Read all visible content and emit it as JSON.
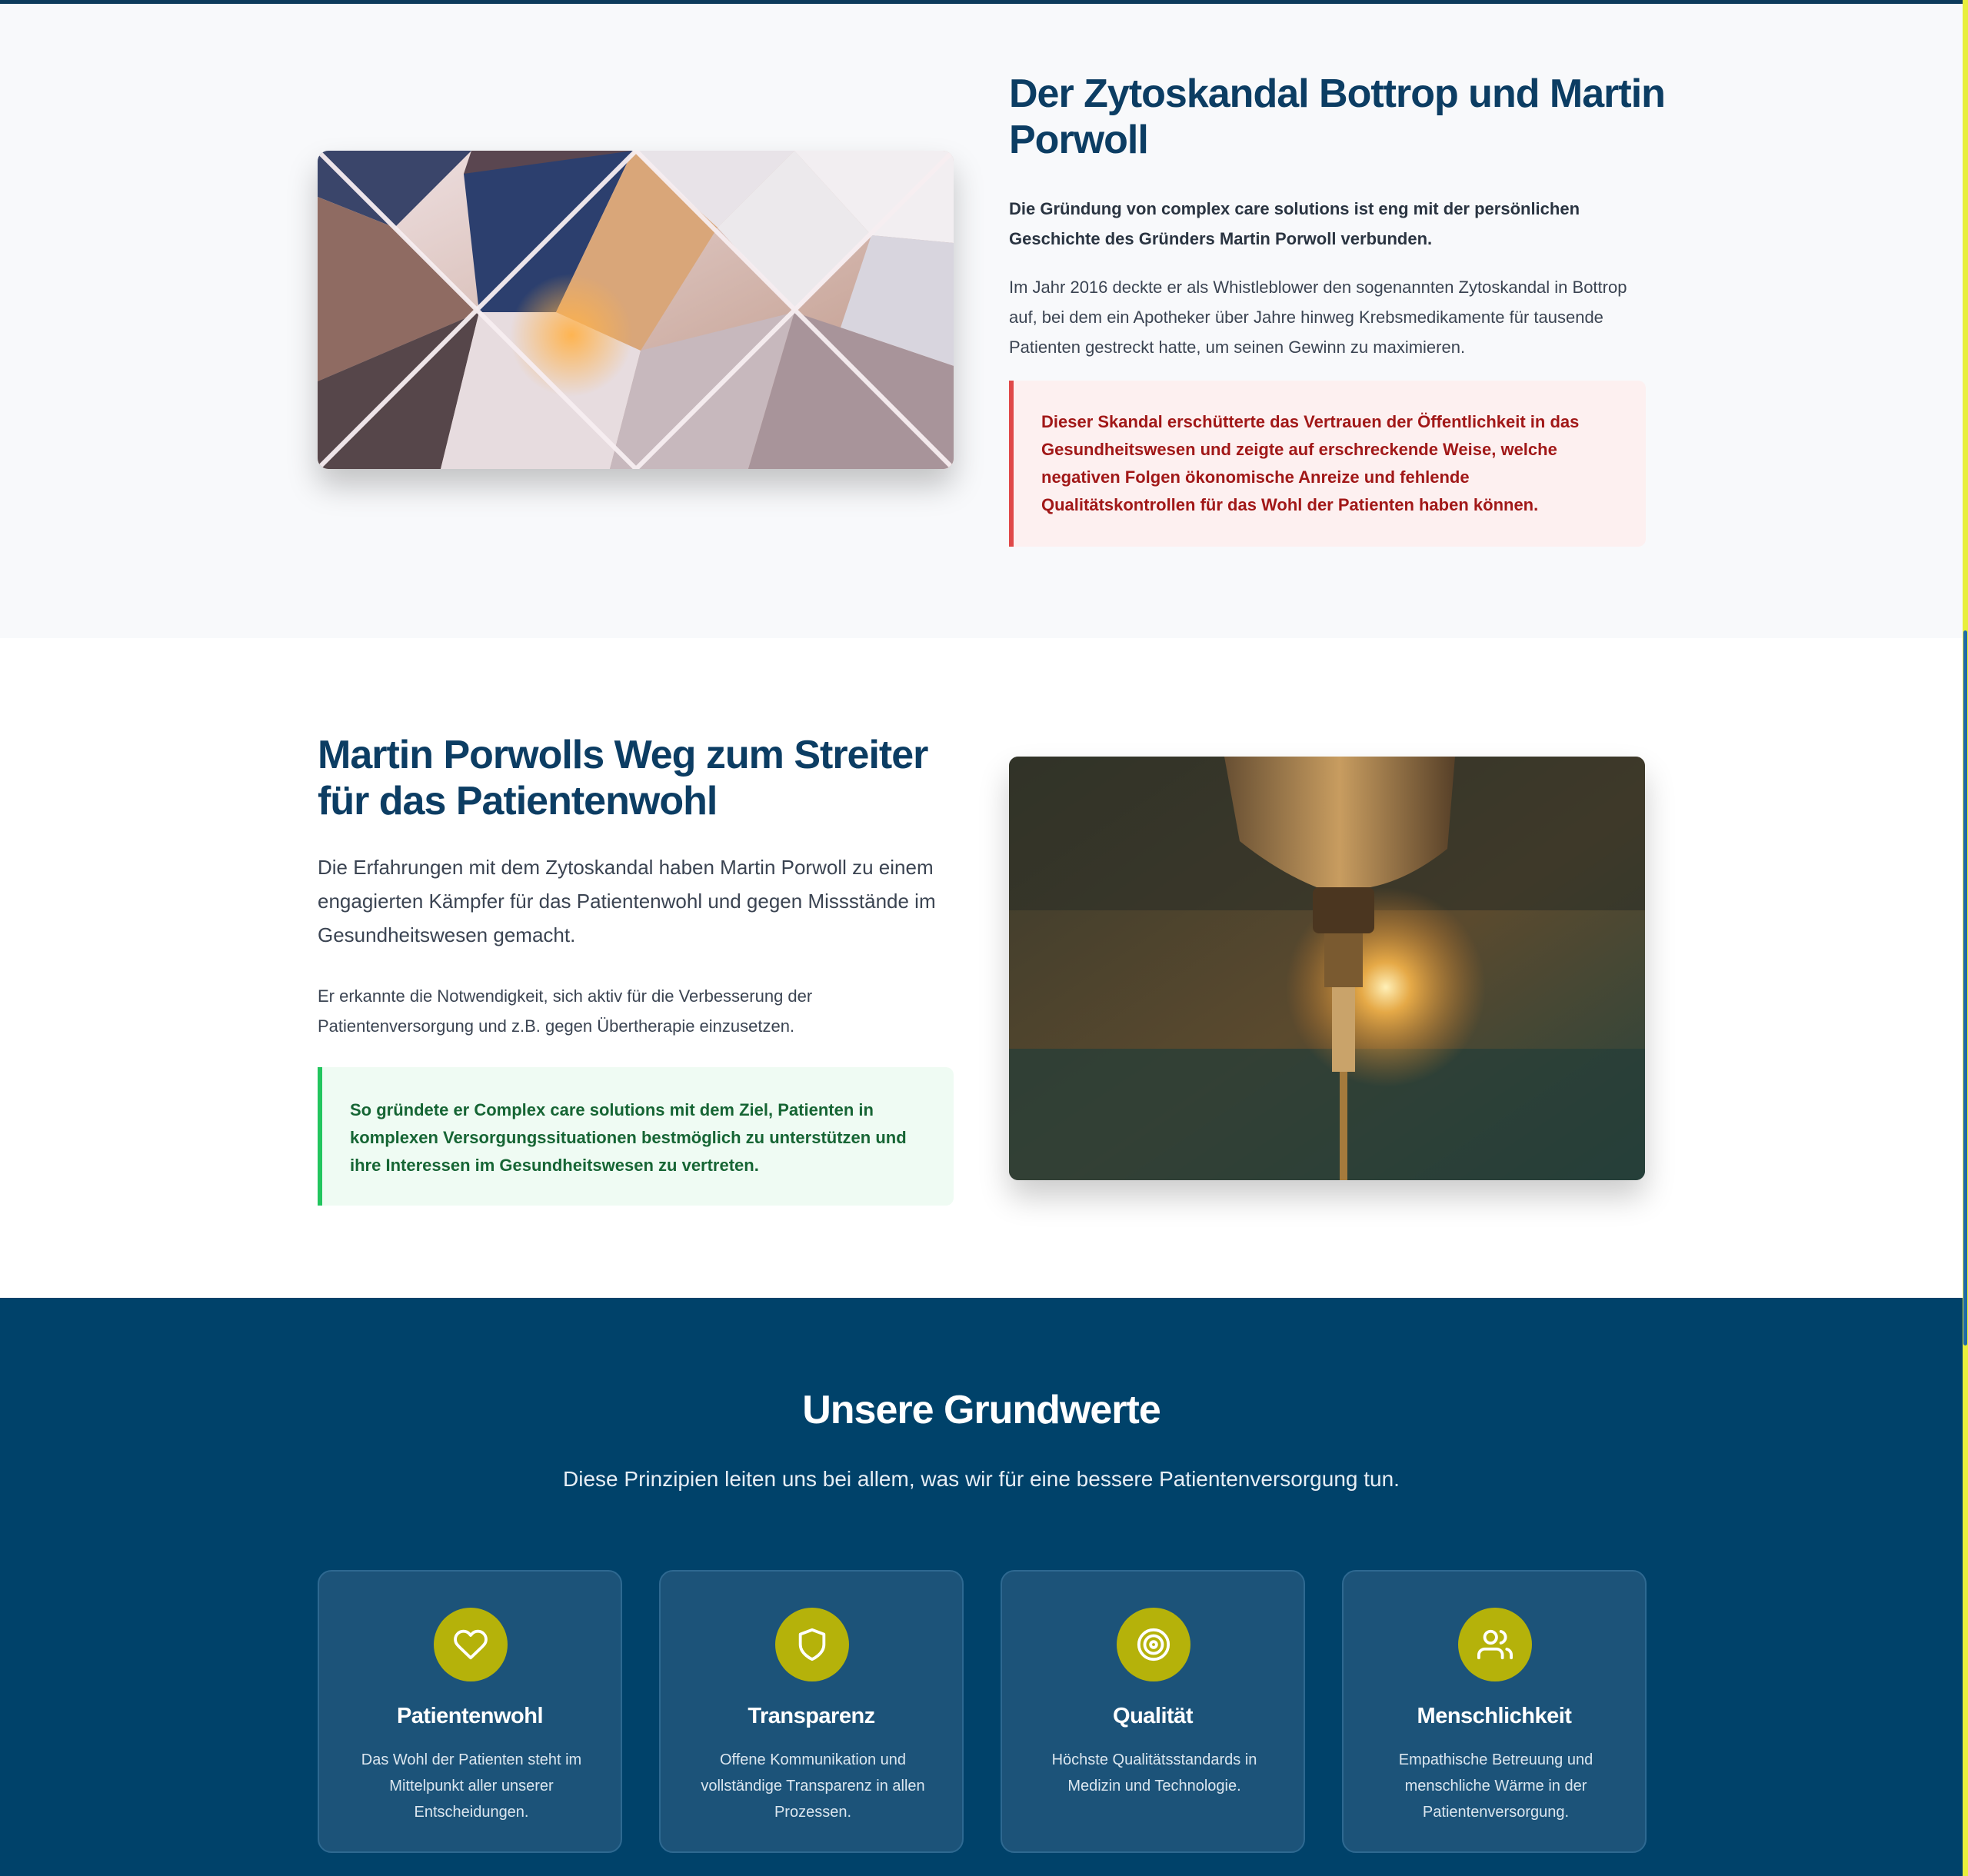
{
  "section1": {
    "title": "Der Zytoskandal Bottrop und Martin Porwoll",
    "lead": "Die Gründung von complex care solutions ist eng mit der persönlichen Geschichte des Gründers Martin Porwoll verbunden.",
    "body": "Im Jahr 2016 deckte er als Whistleblower den sogenannten Zytoskandal in Bottrop auf, bei dem ein Apotheker über Jahre hinweg Krebsmedikamente für tausende Patienten gestreckt hatte, um seinen Gewinn zu maximieren.",
    "alert": "Dieser Skandal erschütterte das Vertrauen der Öffentlichkeit in das Gesundheitswesen und zeigte auf erschreckende Weise, welche negativen Folgen ökonomische Anreize und fehlende Qualitätskontrollen für das Wohl der Patienten haben können."
  },
  "section2": {
    "title": "Martin Porwolls Weg zum Streiter für das Patientenwohl",
    "lead": "Die Erfahrungen mit dem Zytoskandal haben Martin Porwoll zu einem engagierten Kämpfer für das Patientenwohl und gegen Missstände im Gesundheitswesen gemacht.",
    "body": "Er erkannte die Notwendigkeit, sich aktiv für die Verbesserung der Patientenversorgung und z.B. gegen Übertherapie einzusetzen.",
    "alert": "So gründete er Complex care solutions mit dem Ziel, Patienten in komplexen Versorgungssituationen bestmöglich zu unterstützen und ihre Interessen im Gesundheitswesen zu vertreten."
  },
  "values": {
    "title": "Unsere Grundwerte",
    "subtitle": "Diese Prinzipien leiten uns bei allem, was wir für eine bessere Patientenversorgung tun.",
    "cards": [
      {
        "icon": "heart-icon",
        "title": "Patientenwohl",
        "text": "Das Wohl der Patienten steht im Mittelpunkt aller unserer Entscheidungen."
      },
      {
        "icon": "shield-icon",
        "title": "Transparenz",
        "text": "Offene Kommunikation und vollständige Transparenz in allen Prozessen."
      },
      {
        "icon": "target-icon",
        "title": "Qualität",
        "text": "Höchste Qualitätsstandards in Medizin und Technologie."
      },
      {
        "icon": "users-icon",
        "title": "Menschlichkeit",
        "text": "Empathische Betreuung und menschliche Wärme in der Patientenversorgung."
      }
    ]
  },
  "colors": {
    "primary": "#0c3d63",
    "navy_band": "#00426a",
    "accent_olive": "#b5b20a",
    "alert_red": "#e04848",
    "alert_green": "#22c55e"
  }
}
